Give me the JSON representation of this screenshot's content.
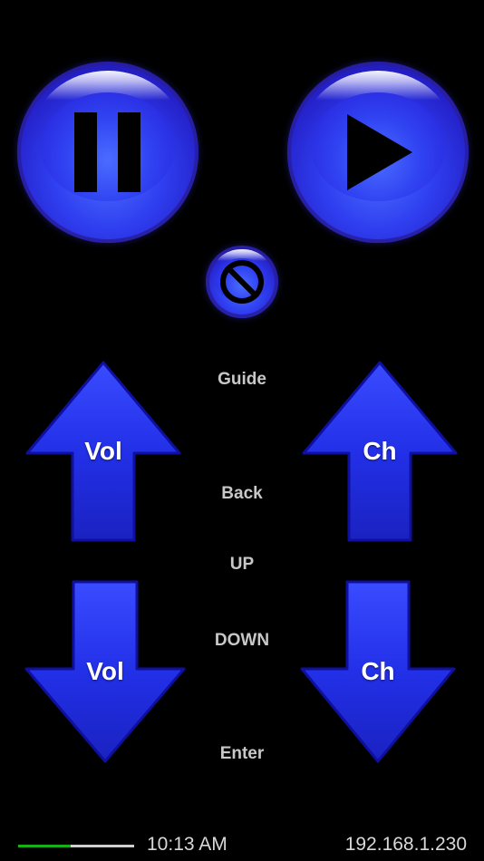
{
  "colors": {
    "button_blue": "#2f3ff0",
    "label_gray": "#c8c8c8",
    "progress_green": "#17b017"
  },
  "controls": {
    "pause_icon": "pause-icon",
    "play_icon": "play-icon",
    "stop_icon": "no-symbol-icon"
  },
  "arrows": {
    "vol_up": "Vol",
    "ch_up": "Ch",
    "vol_down": "Vol",
    "ch_down": "Ch"
  },
  "commands": {
    "guide": "Guide",
    "back": "Back",
    "up": "UP",
    "down": "DOWN",
    "enter": "Enter"
  },
  "status": {
    "time": "10:13 AM",
    "ip": "192.168.1.230",
    "progress_fraction": 0.45
  }
}
